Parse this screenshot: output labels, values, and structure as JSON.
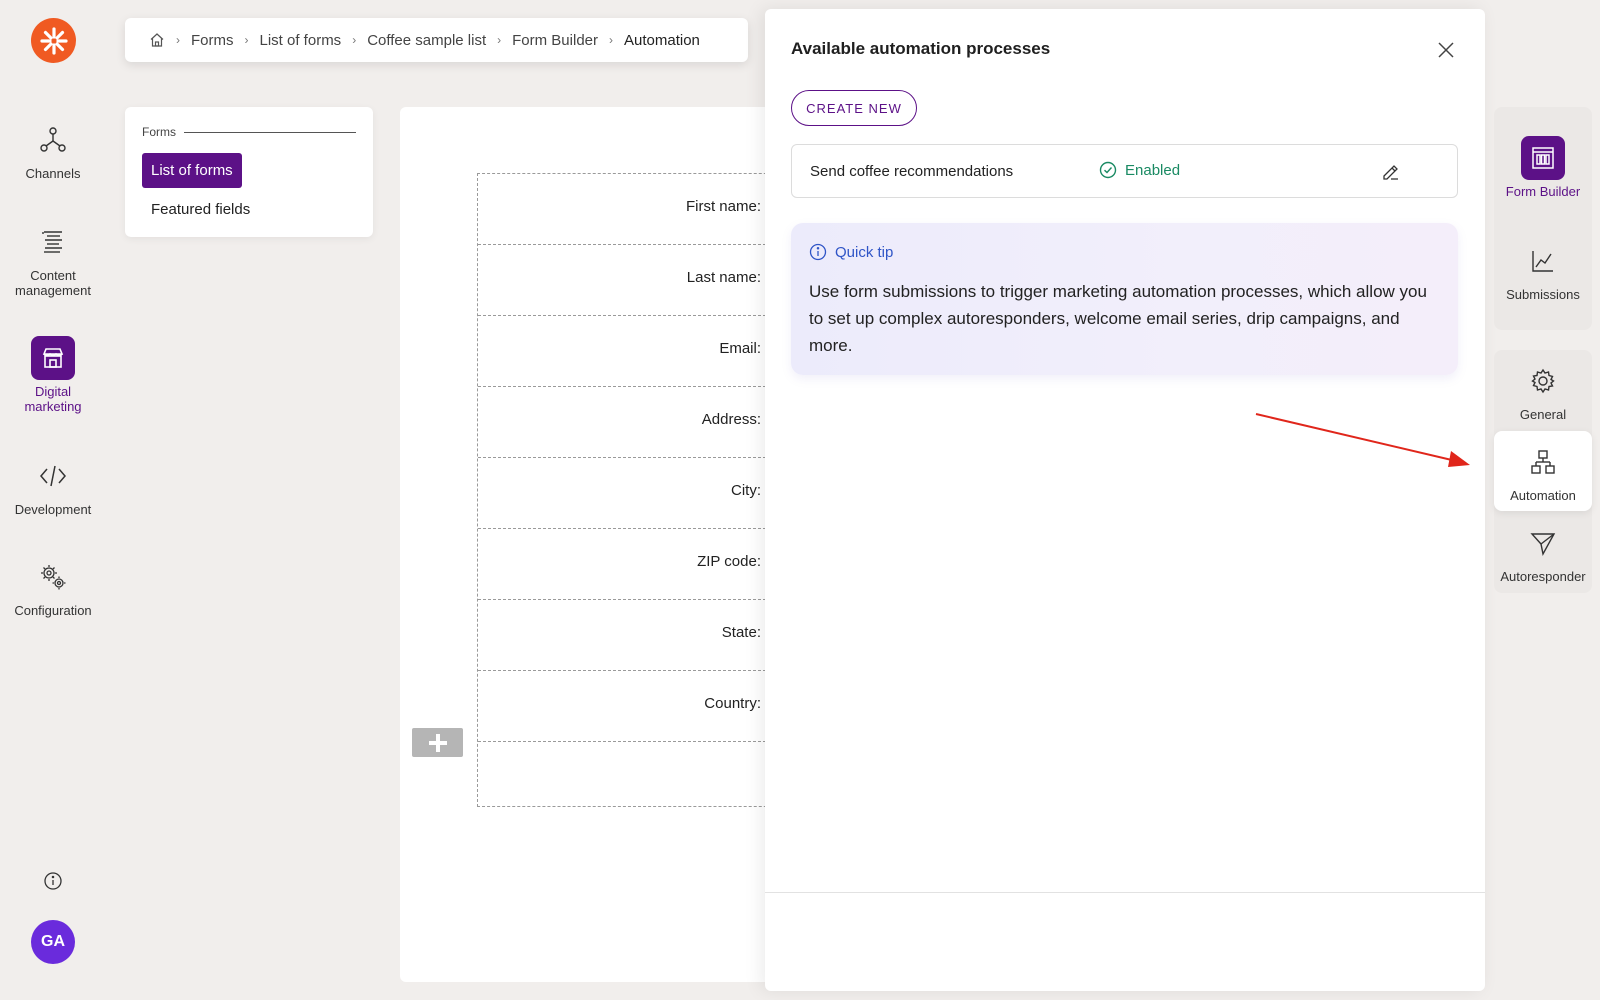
{
  "nav": {
    "items": [
      {
        "label": "Channels",
        "icon": "channels-icon"
      },
      {
        "label": "Content management",
        "icon": "content-management-icon"
      },
      {
        "label": "Digital marketing",
        "icon": "digital-marketing-icon",
        "active": true
      },
      {
        "label": "Development",
        "icon": "code-icon"
      },
      {
        "label": "Configuration",
        "icon": "gears-icon"
      }
    ],
    "avatar_initials": "GA"
  },
  "breadcrumb": [
    "Forms",
    "List of forms",
    "Coffee sample list",
    "Form Builder",
    "Automation"
  ],
  "forms_panel": {
    "section_label": "Forms",
    "items": [
      "List of forms",
      "Featured fields"
    ]
  },
  "form_fields": [
    "First name:",
    "Last name:",
    "Email:",
    "Address:",
    "City:",
    "ZIP code:",
    "State:",
    "Country:"
  ],
  "modal": {
    "title": "Available automation processes",
    "create_button": "CREATE NEW",
    "process": {
      "name": "Send coffee recommendations",
      "status": "Enabled"
    },
    "tip": {
      "title": "Quick tip",
      "text": "Use form submissions to trigger marketing automation processes, which allow you to set up complex autoresponders, welcome email series, drip campaigns, and more."
    }
  },
  "side_tabs": {
    "group1": [
      {
        "label": "Form Builder",
        "icon": "form-builder-icon"
      },
      {
        "label": "Submissions",
        "icon": "chart-icon"
      }
    ],
    "group2": [
      {
        "label": "General",
        "icon": "gear-icon"
      },
      {
        "label": "Automation",
        "icon": "automation-icon"
      },
      {
        "label": "Autoresponder",
        "icon": "send-icon"
      }
    ]
  },
  "colors": {
    "brand_purple": "#5c1187",
    "logo_orange": "#f05a22",
    "enabled_green": "#1a8a63",
    "tip_blue": "#2f55c7",
    "arrow_red": "#e0261b"
  }
}
